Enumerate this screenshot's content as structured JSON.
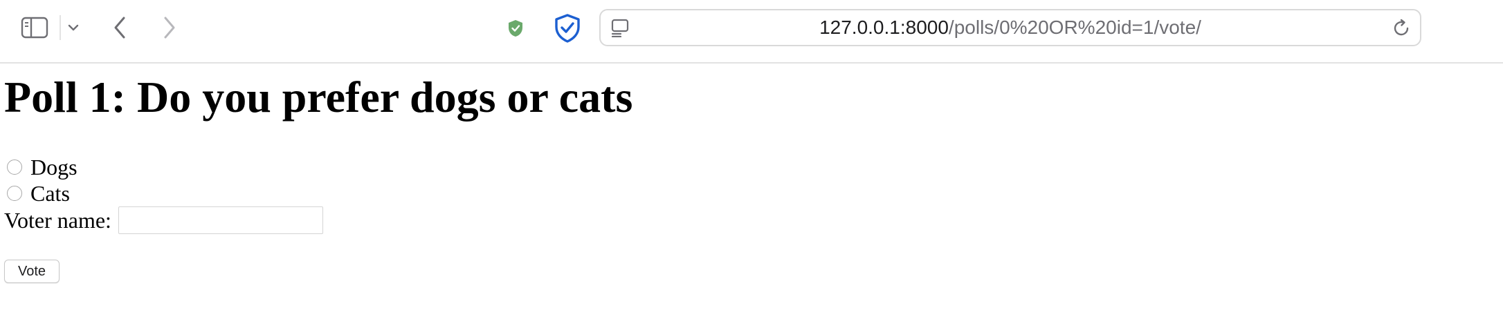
{
  "browser": {
    "toolbar": {
      "icons": {
        "sidebar": "sidebar-icon",
        "tab_menu": "chevron-down-icon",
        "back": "chevron-left-icon",
        "forward": "chevron-right-icon",
        "privacy_shield": "green-shield-icon",
        "extension": "blue-shield-check-icon",
        "page": "page-icon",
        "reload": "reload-icon"
      },
      "colors": {
        "green_shield": "#6aa96b",
        "blue_shield": "#1c5fd1",
        "icon_gray": "#6e6e73"
      }
    },
    "address_bar": {
      "host": "127.0.0.1:8000",
      "path": "/polls/0%20OR%20id=1/vote/"
    }
  },
  "page": {
    "title": "Poll 1: Do you prefer dogs or cats",
    "choices": [
      {
        "label": "Dogs",
        "selected": false
      },
      {
        "label": "Cats",
        "selected": false
      }
    ],
    "voter_label": "Voter name:",
    "voter_value": "",
    "vote_button": "Vote"
  }
}
